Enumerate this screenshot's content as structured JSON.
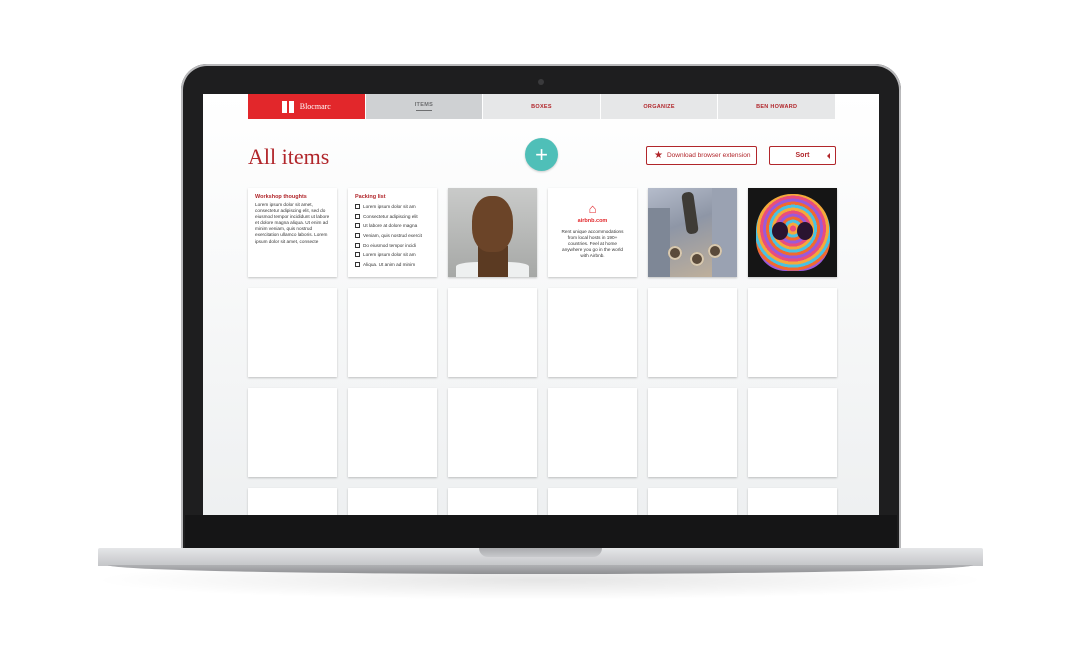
{
  "app": {
    "brand_name": "Blocmarc",
    "nav_tabs": [
      {
        "label": "ITEMS",
        "active": true
      },
      {
        "label": "BOXES",
        "active": false
      },
      {
        "label": "ORGANIZE",
        "active": false
      },
      {
        "label": "BEN HOWARD",
        "active": false
      }
    ]
  },
  "page": {
    "title": "All items",
    "add_icon": "plus-icon",
    "download_label": "Download browser extension",
    "download_icon": "star-icon",
    "sort_label": "Sort"
  },
  "cards": {
    "note": {
      "title": "Workshop thoughts",
      "body": "Lorem ipsum dolor sit amet, consectetur adipiscing elit, sed do eiusmod tempor incididunt ut labore et dolore magna aliqua. Ut enim ad minim veniam, quis nostrud exercitation ullamco laboris. Lorem ipsum dolor sit amet, consecte"
    },
    "checklist": {
      "title": "Packing list",
      "items": [
        "Lorem ipsum dolor sit am",
        "Consectetur adipiscing elit",
        "Ut labore at dolore magna",
        "Veniam, quis nostrud exercit",
        "Do eiusmod tempor incidi",
        "Lorem ipsum dolor sit am",
        "Aliqua. Ut anim ad minim"
      ]
    },
    "airbnb": {
      "logo_icon": "airbnb-logo-icon",
      "name": "airbnb.com",
      "text": "Rent unique accommodations from local hosts in 190+ countries. Feel at home anywhere you go in the world with Airbnb."
    }
  },
  "colors": {
    "brand_red": "#e2272b",
    "text_red": "#b1262b",
    "accent_teal": "#4fbfb8"
  }
}
